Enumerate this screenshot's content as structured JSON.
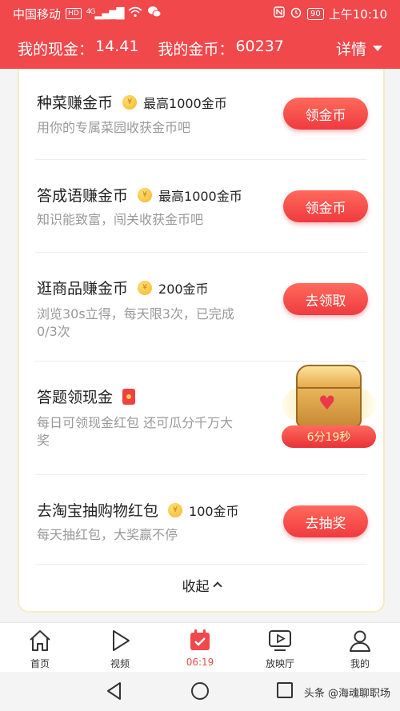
{
  "status_bar": {
    "carrier": "中国移动",
    "hd": "HD",
    "network": "4G",
    "battery": "90",
    "time": "上午10:10"
  },
  "header": {
    "cash_label": "我的现金：",
    "cash_value": "14.41",
    "coins_label": "我的金币：",
    "coins_value": "60237",
    "detail_label": "详情"
  },
  "tasks": [
    {
      "title": "种菜赚金币",
      "reward": "最高1000金币",
      "desc_lines": [
        "用你的专属菜园收获金币吧"
      ],
      "button": "领金币"
    },
    {
      "title": "答成语赚金币",
      "reward": "最高1000金币",
      "desc_lines": [
        "知识能致富，闯关收获金币吧"
      ],
      "button": "领金币"
    },
    {
      "title": "逛商品赚金币",
      "reward": "200金币",
      "desc_lines": [
        "浏览30s立得，每天限3次，已完成",
        "0/3次"
      ],
      "button": "去领取"
    },
    {
      "title": "答题领现金",
      "reward": "",
      "desc_lines": [
        "每日可领现金红包 还可瓜分千万大",
        "奖"
      ],
      "timer": "6分19秒"
    },
    {
      "title": "去淘宝抽购物红包",
      "reward": "100金币",
      "desc_lines": [
        "每天抽红包，大奖赢不停"
      ],
      "button": "去抽奖"
    }
  ],
  "collapse_label": "收起",
  "tabbar": {
    "items": [
      {
        "label": "首页",
        "icon": "home-icon"
      },
      {
        "label": "视频",
        "icon": "play-icon"
      },
      {
        "label": "06:19",
        "icon": "calendar-check-icon",
        "active": true
      },
      {
        "label": "放映厅",
        "icon": "tv-icon"
      },
      {
        "label": "我的",
        "icon": "person-icon"
      }
    ]
  },
  "watermark": "头条 @海魂聊职场",
  "colors": {
    "brand_red": "#f0484b",
    "button_red": "#f03a3f",
    "coin_gold": "#f5b323"
  }
}
